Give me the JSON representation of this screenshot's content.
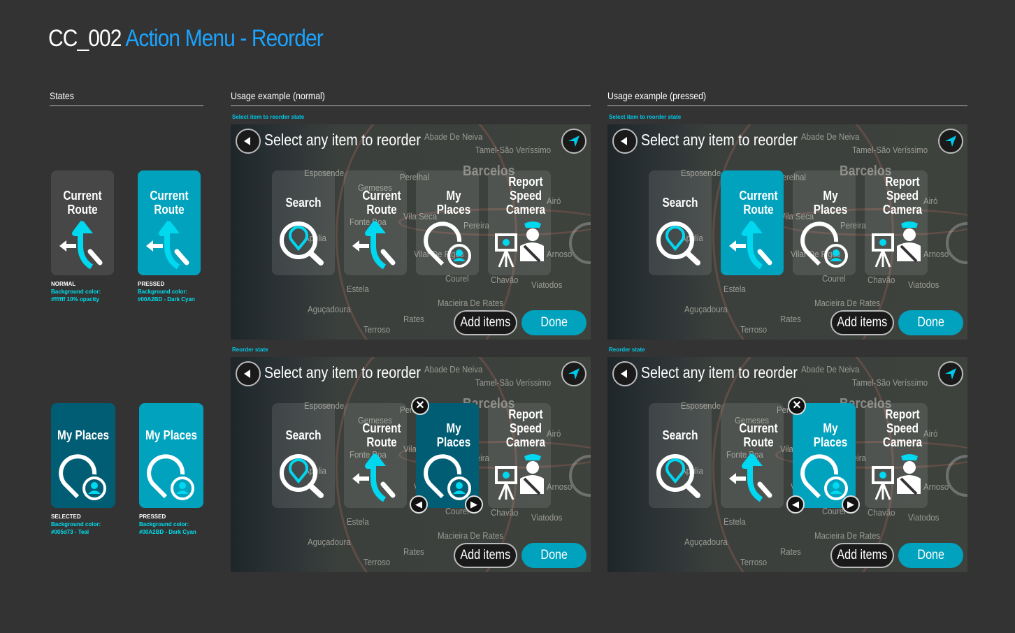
{
  "header": {
    "prefix": "CC_002",
    "title": "Action Menu - Reorder"
  },
  "sections": {
    "states": "States",
    "normal": "Usage example (normal)",
    "pressed": "Usage example (pressed)"
  },
  "colors": {
    "tile_normal": "#ffffff1a",
    "dark_cyan": "#00A2BD",
    "teal": "#005d73",
    "accent": "#1aa3ff",
    "arrow_cyan": "#00d8f0"
  },
  "states": [
    {
      "label": "Current Route",
      "icon": "current-route-icon",
      "state": "NORMAL",
      "bg_label": "Background color:",
      "bg_value": "#ffffff 10% opacity"
    },
    {
      "label": "Current Route",
      "icon": "current-route-icon",
      "state": "PRESSED",
      "bg_label": "Background color:",
      "bg_value": "#00A2BD - Dark Cyan"
    },
    {
      "label": "My Places",
      "icon": "my-places-icon",
      "state": "SELECTED",
      "bg_label": "Background color:",
      "bg_value": "#005d73 - Teal"
    },
    {
      "label": "My Places",
      "icon": "my-places-icon",
      "state": "PRESSED",
      "bg_label": "Background color:",
      "bg_value": "#00A2BD - Dark Cyan"
    }
  ],
  "screen": {
    "title": "Select any item to reorder",
    "add_items": "Add items",
    "done": "Done",
    "items": [
      {
        "label": "Search",
        "icon": "search-icon"
      },
      {
        "label": "Current Route",
        "icon": "current-route-icon"
      },
      {
        "label": "My Places",
        "icon": "my-places-icon"
      },
      {
        "label": "Report Speed Camera",
        "icon": "speed-camera-icon"
      }
    ],
    "map_labels": [
      "Abade De Neiva",
      "Tamel-São Veríssimo",
      "Esposende",
      "Perelhal",
      "Barcelos",
      "Gemeses",
      "Fonte Boa",
      "Vila Seca",
      "Pereira",
      "Apúlia",
      "Vilar De Figos",
      "Courel",
      "Chavão",
      "Viatodos",
      "Estela",
      "Macieira De Rates",
      "Aguçadoura",
      "Rates",
      "Terroso",
      "Airó",
      "Arnoso"
    ]
  },
  "examples": [
    {
      "caption": "Select item to reorder state",
      "highlight": -1,
      "mode": "none"
    },
    {
      "caption": "Select item to reorder state",
      "highlight": 1,
      "mode": "pressed"
    },
    {
      "caption": "Reorder state",
      "highlight": 2,
      "mode": "selected"
    },
    {
      "caption": "Reorder state",
      "highlight": 2,
      "mode": "pressed"
    }
  ]
}
